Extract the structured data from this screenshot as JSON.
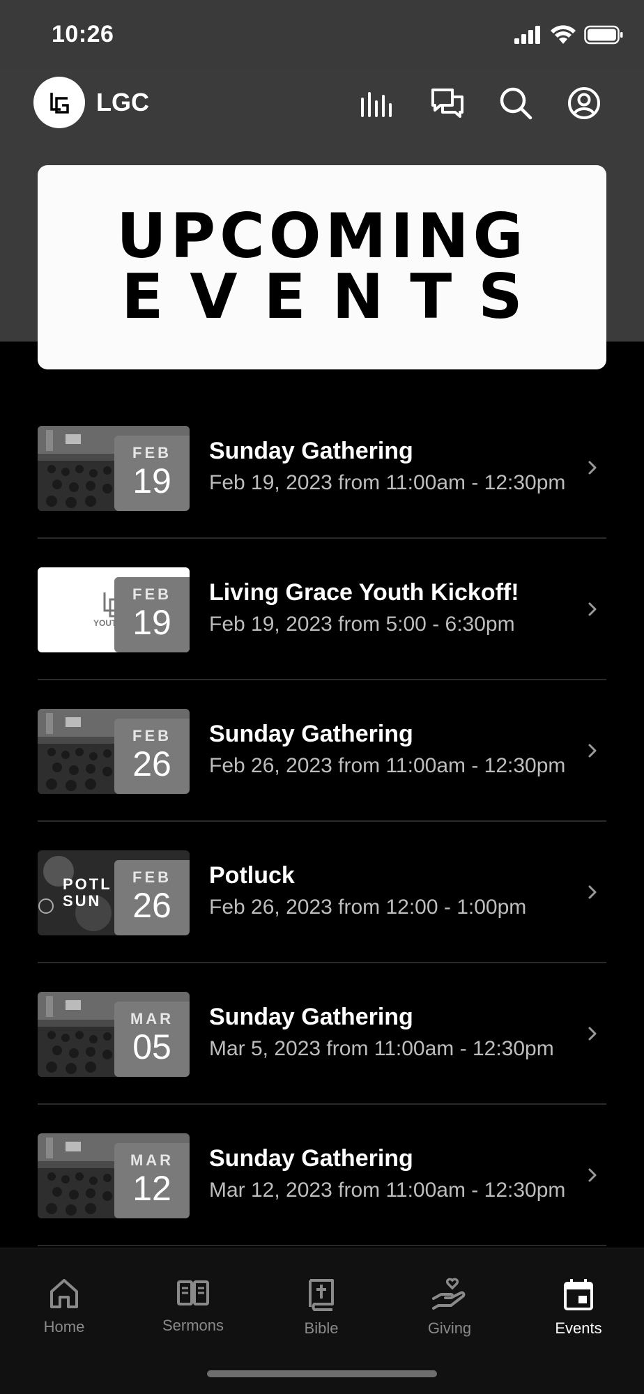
{
  "status_bar": {
    "time": "10:26",
    "icons": [
      "signal-icon",
      "wifi-icon",
      "battery-icon"
    ]
  },
  "header": {
    "logo_text": "LG",
    "app_name": "LGC",
    "icons": [
      "equalizer-icon",
      "chat-icon",
      "search-icon",
      "profile-icon"
    ]
  },
  "banner": {
    "line1": "UPCOMING",
    "line2": "EVENTS"
  },
  "events": [
    {
      "month": "FEB",
      "day": "19",
      "title": "Sunday Gathering",
      "subtitle": "Feb 19, 2023 from 11:00am - 12:30pm",
      "thumb": "congregation"
    },
    {
      "month": "FEB",
      "day": "19",
      "title": "Living Grace Youth Kickoff!",
      "subtitle": "Feb 19, 2023 from 5:00 - 6:30pm",
      "thumb": "youth-logo"
    },
    {
      "month": "FEB",
      "day": "26",
      "title": "Sunday Gathering",
      "subtitle": "Feb 26, 2023 from 11:00am - 12:30pm",
      "thumb": "congregation"
    },
    {
      "month": "FEB",
      "day": "26",
      "title": "Potluck",
      "subtitle": "Feb 26, 2023 from 12:00 - 1:00pm",
      "thumb": "potluck"
    },
    {
      "month": "MAR",
      "day": "05",
      "title": "Sunday Gathering",
      "subtitle": "Mar 5, 2023 from 11:00am - 12:30pm",
      "thumb": "congregation"
    },
    {
      "month": "MAR",
      "day": "12",
      "title": "Sunday Gathering",
      "subtitle": "Mar 12, 2023 from 11:00am - 12:30pm",
      "thumb": "congregation"
    }
  ],
  "tabs": [
    {
      "label": "Home",
      "icon": "home-icon",
      "active": false
    },
    {
      "label": "Sermons",
      "icon": "book-open-icon",
      "active": false
    },
    {
      "label": "Bible",
      "icon": "bible-icon",
      "active": false
    },
    {
      "label": "Giving",
      "icon": "giving-hand-icon",
      "active": false
    },
    {
      "label": "Events",
      "icon": "calendar-icon",
      "active": true
    }
  ],
  "colors": {
    "background": "#000000",
    "header": "#3b3b3b",
    "banner": "#fbfbfb",
    "date_box": "#7a7a7a",
    "subtitle": "#bdbdbd",
    "tab_inactive": "#8a8a8a",
    "tab_active": "#ffffff"
  }
}
